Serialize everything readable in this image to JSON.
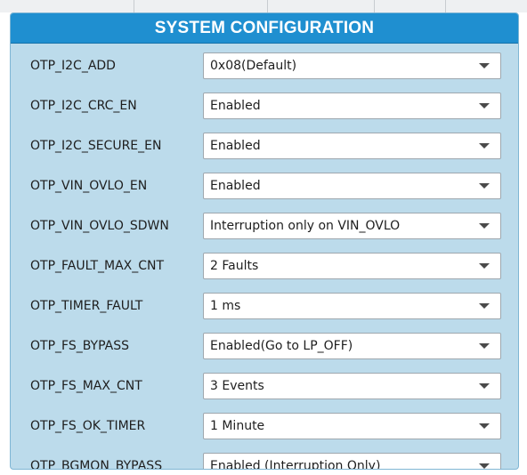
{
  "panel": {
    "title": "SYSTEM CONFIGURATION"
  },
  "rows": [
    {
      "label": "OTP_I2C_ADD",
      "value": "0x08(Default)"
    },
    {
      "label": "OTP_I2C_CRC_EN",
      "value": "Enabled"
    },
    {
      "label": "OTP_I2C_SECURE_EN",
      "value": "Enabled"
    },
    {
      "label": "OTP_VIN_OVLO_EN",
      "value": "Enabled"
    },
    {
      "label": "OTP_VIN_OVLO_SDWN",
      "value": "Interruption only on VIN_OVLO"
    },
    {
      "label": "OTP_FAULT_MAX_CNT",
      "value": "2 Faults"
    },
    {
      "label": "OTP_TIMER_FAULT",
      "value": "1 ms"
    },
    {
      "label": "OTP_FS_BYPASS",
      "value": "Enabled(Go to LP_OFF)"
    },
    {
      "label": "OTP_FS_MAX_CNT",
      "value": "3 Events"
    },
    {
      "label": "OTP_FS_OK_TIMER",
      "value": "1 Minute"
    },
    {
      "label": "OTP_BGMON_BYPASS",
      "value": "Enabled (Interruption Only)"
    }
  ],
  "icons": {
    "dropdown": "chevron-down-icon"
  }
}
